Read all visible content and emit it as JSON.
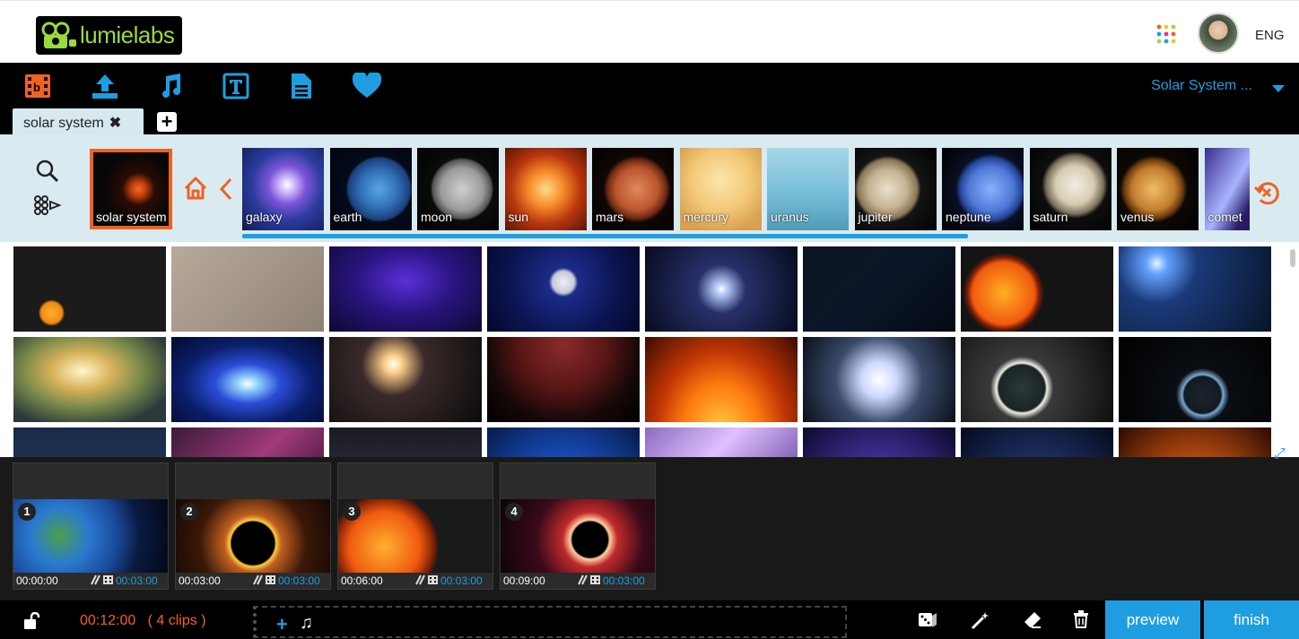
{
  "brand": {
    "name": "lumielabs"
  },
  "header": {
    "language": "ENG",
    "apps_icon": "apps-grid-icon",
    "avatar_icon": "user-avatar"
  },
  "toolbar": {
    "tools": [
      {
        "name": "storyblocks-video-icon",
        "color": "#f0621f"
      },
      {
        "name": "upload-icon",
        "color": "#1e9ee0"
      },
      {
        "name": "music-note-icon",
        "color": "#1e9ee0"
      },
      {
        "name": "text-icon",
        "color": "#1e9ee0"
      },
      {
        "name": "document-icon",
        "color": "#1e9ee0"
      },
      {
        "name": "heart-icon",
        "color": "#1e9ee0"
      }
    ],
    "project_name": "Solar System ...",
    "tab_label": "solar system",
    "tab_close": "✖",
    "add_tab": "+"
  },
  "categories": {
    "current": {
      "label": "solar system"
    },
    "items": [
      {
        "label": "galaxy",
        "bg": "radial-gradient(ellipse at 55% 45%,#ffffff 0,#d7c3ff 10%,#7a55d8 30%,#2c3c9e 55%,#111a4e 100%)"
      },
      {
        "label": "earth",
        "bg": "radial-gradient(circle at 60% 50%,#5aa6e5 0,#2f6fb6 30%,#1c3f7a 48%,#050a1a 52%,#02040c 100%)"
      },
      {
        "label": "moon",
        "bg": "radial-gradient(circle at 55% 50%,#d0d0d0 0,#9a9a9a 35%,#555 48%,#0b0b0b 52%,#000 100%)"
      },
      {
        "label": "sun",
        "bg": "radial-gradient(circle at 50% 50%,#ffdb8a 0,#f78a2a 30%,#b8360d 60%,#5a1405 100%)"
      },
      {
        "label": "mars",
        "bg": "radial-gradient(circle at 55% 50%,#e08a5a 0,#b9552e 35%,#6e2a14 48%,#100605 55%,#000 100%)"
      },
      {
        "label": "mercury",
        "bg": "radial-gradient(circle at 50% 40%,#fbe6ac 0,#f3c978 45%,#d8a252 80%)"
      },
      {
        "label": "uranus",
        "bg": "linear-gradient(180deg,#a6d6e7 0,#7cc0da 50%,#4f9cb9 100%)"
      },
      {
        "label": "jupiter",
        "bg": "radial-gradient(circle at 40% 50%,#e9e0cc 0,#c6b392 30%,#8a7658 46%,#141414 52%,#000 100%)"
      },
      {
        "label": "neptune",
        "bg": "radial-gradient(circle at 60% 50%,#8ab2ff 0,#4f78d6 35%,#26459b 48%,#0a0f22 55%,#000 100%)"
      },
      {
        "label": "saturn",
        "bg": "radial-gradient(ellipse at 55% 45%,#f2eee3 0,#d6ccb2 30%,#7a705c 45%,#0e0e0e 52%,#000 100%)"
      },
      {
        "label": "venus",
        "bg": "radial-gradient(circle at 45% 50%,#f0bd6a 0,#c27d2e 35%,#6b3b10 48%,#0e0804 55%,#000 100%)"
      },
      {
        "label": "comet",
        "bg": "linear-gradient(120deg,#3a2d8f 0,#a8b4ff 40%,#2a1f6a 60%,#0c0a2a 100%)"
      }
    ],
    "scroll_fraction": 0.72
  },
  "results": [
    "radial-gradient(circle at 25% 78%,#ffb030 0,#f08a10 8%,#1b1b1b 10%),linear-gradient(160deg,#0a0a0a 0,#3a3a3a 55%,#0a0a0a 100%)",
    "linear-gradient(135deg,#b7aa98 0,#a3968a 50%,#8e8274 100%)",
    "radial-gradient(ellipse at 50% 40%,#5a2fd8 0,#2a1480 45%,#0e0830 100%)",
    "radial-gradient(circle at 50% 42%,#f0f0f5 0,#c8c8d8 12%,#1b2c8a 16%,#0b1450 60%,#04082a 100%)",
    "radial-gradient(circle at 50% 50%,#ffffff 0,#b9d0ff 6%,#28306a 28%,#060a1c 100%)",
    "linear-gradient(135deg,#0c1420 0,#0a1628 50%,#050a14 100%)",
    "radial-gradient(circle at 28% 55%,#ffb020 0,#f05a10 26%,#7a1e05 30%,#141414 34%),linear-gradient(90deg,#111 0,#6a6a6a 80%,#222 100%)",
    "radial-gradient(circle at 25% 20%,#e6f3ff 0,#63a3ff 8%,#1b3a7a 30%,#071428 100%)",
    "radial-gradient(ellipse at 45% 40%,#fff6c8 0,#d9b35b 25%,#7a8a4a 50%,#2b3a3a 80%)",
    "radial-gradient(ellipse at 50% 55%,#ffffff 0,#8fd0ff 10%,#2a4dd6 30%,#0b1e6a 60%,#050a2a 100%)",
    "radial-gradient(circle at 42% 32%,#ffffff 0,#ffd08a 8%,#3a2a2a 30%,#0a0a0a 100%)",
    "radial-gradient(ellipse at 50% 10%,#8a2a2a 0,#5a1616 40%,#160808 70%,#000 100%)",
    "radial-gradient(ellipse at 50% 110%,#ffcc40 0,#ff7a10 35%,#c03605 60%,#3a0a02 100%)",
    "radial-gradient(circle at 50% 50%,#ffffff 0,#cfd8ff 20%,#3a4a6a 50%,#0a0e18 100%)",
    "radial-gradient(circle at 40% 60%,#2a3a3a 0,#1a2424 22%,#f0f0e6 24%,#3a3a3a 30%,#0a0a0a 100%)",
    "radial-gradient(circle at 55% 68%,#1b2430 0,#121a22 18%,#7aaad0 20%,#0a0e14 26%,#000 100%)",
    "linear-gradient(180deg,#1a2a4a 0,#2a3a5a 100%)",
    "linear-gradient(135deg,#3a1a3a 0,#a03a7a 50%,#2a0a2a 100%)",
    "linear-gradient(180deg,#1a1a24 0,#3a3a4a 100%)",
    "radial-gradient(ellipse at 50% 100%,#4ac0ff 0,#1a50c0 40%,#061a4a 100%)",
    "linear-gradient(135deg,#8a6ac0 0,#e0c0ff 40%,#4a2a8a 100%)",
    "radial-gradient(ellipse at 50% 100%,#8a6aff 0,#3a2a8a 50%,#0a0a2a 100%)",
    "radial-gradient(ellipse at 50% 100%,#2a4a8a 0,#1a2a5a 50%,#050a1a 100%)",
    "radial-gradient(ellipse at 50% 100%,#ffa040 0,#c05010 40%,#2a0a02 100%)"
  ],
  "timeline": {
    "clips": [
      {
        "number": "1",
        "start": "00:00:00",
        "duration": "00:03:00",
        "bg": "radial-gradient(circle at 30% 50%,#4aa04a 0,#2a7ad0 25%,#1a4a9a 50%,#0a1a40 70%,#040818 100%)"
      },
      {
        "number": "2",
        "start": "00:03:00",
        "duration": "00:03:00",
        "bg": "radial-gradient(circle at 50% 60%,#000 0,#000 24%,#ffcc40 26%,#c06020 32%,#3a1808 60%,#160804 100%)"
      },
      {
        "number": "3",
        "start": "00:06:00",
        "duration": "00:03:00",
        "bg": "radial-gradient(circle at 30% 65%,#ffb030 0,#f05a10 30%,#7a1e05 42%,#1a1a1a 46%),linear-gradient(90deg,#111 0,#aaa 75%,#222 100%)"
      },
      {
        "number": "4",
        "start": "00:09:00",
        "duration": "00:03:00",
        "bg": "radial-gradient(circle at 58% 55%,#000 0,#000 18%,#ffd0a0 20%,#c02a2a 28%,#3a0a1a 55%,#0a0408 100%)"
      }
    ]
  },
  "bottom": {
    "total_time": "00:12:00",
    "clips_count": "( 4 clips )",
    "drop_plus": "+",
    "drop_music": "♫",
    "preview_label": "preview",
    "finish_label": "finish"
  }
}
